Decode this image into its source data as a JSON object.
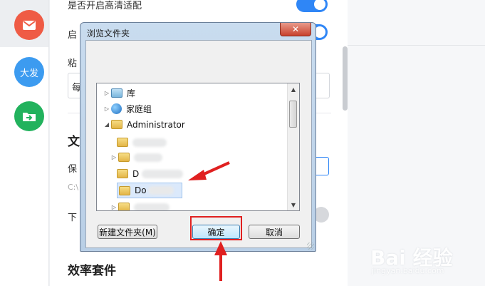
{
  "rail": {
    "icons": [
      {
        "name": "mail",
        "label": "",
        "color": "#ef5b45"
      },
      {
        "name": "dafa",
        "label": "大发",
        "color": "#3c9bf0"
      },
      {
        "name": "file-transfer",
        "label": "",
        "color": "#22b25d"
      }
    ]
  },
  "settings": {
    "row1_label": "是否开启高清适配",
    "row2_label_partial": "启",
    "row3_label_partial": "粘",
    "input1_partial": "每",
    "section_file_partial": "文",
    "save_label_partial": "保",
    "path_partial": "C:\\",
    "download_label_partial": "下",
    "section_efficiency": "效率套件"
  },
  "dialog": {
    "title": "浏览文件夹",
    "close_glyph": "✕",
    "tree": [
      {
        "label": "库",
        "icon": "library-icon",
        "indent": 0,
        "expander": "▷"
      },
      {
        "label": "家庭组",
        "icon": "homegroup-icon",
        "indent": 0,
        "expander": "▷"
      },
      {
        "label": "Administrator",
        "icon": "user-folder-icon",
        "indent": 0,
        "expander": "◢"
      },
      {
        "label": "",
        "icon": "folder-icon",
        "indent": 1,
        "expander": ""
      },
      {
        "label": "",
        "icon": "folder-icon",
        "indent": 1,
        "expander": "▷"
      },
      {
        "label": "D",
        "icon": "folder-icon",
        "indent": 1,
        "expander": ""
      },
      {
        "label": "Do",
        "icon": "folder-icon",
        "indent": 1,
        "expander": "",
        "selected": true
      },
      {
        "label": "",
        "icon": "folder-icon",
        "indent": 1,
        "expander": "▷"
      }
    ],
    "new_folder_button": "新建文件夹(M)",
    "ok_button": "确定",
    "cancel_button": "取消"
  },
  "watermark": {
    "main": "Bai 经验",
    "sub": "jingyan.baidu.com"
  },
  "colors": {
    "accent": "#2f86f6",
    "annotation_red": "#e02020"
  }
}
